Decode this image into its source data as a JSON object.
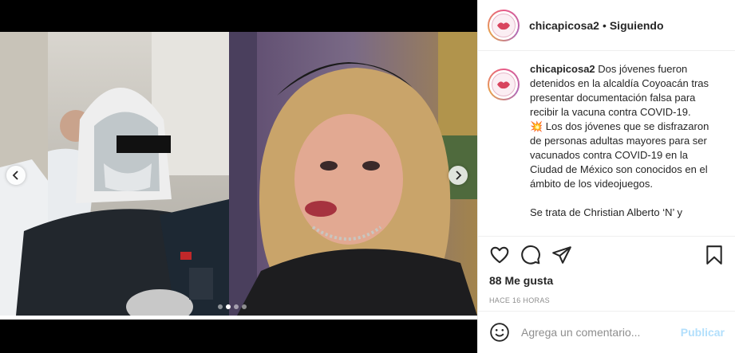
{
  "post": {
    "username": "chicapicosa2",
    "separator": "•",
    "follow_label": "Siguiendo",
    "caption_user": "chicapicosa2",
    "caption_p1": " Dos jóvenes fueron detenidos en la alcaldía Coyoacán tras presentar documentación falsa para recibir la vacuna contra COVID-19.",
    "caption_p2": "💥 Los dos jóvenes que se disfrazaron de personas adultas mayores para ser vacunados contra COVID-19 en la Ciudad de México son conocidos en el ámbito de los videojuegos.",
    "caption_p3": "Se trata de Christian Alberto ‘N’ y",
    "likes": "88 Me gusta",
    "time": "HACE 16 HORAS",
    "comment_placeholder": "Agrega un comentario...",
    "publish_label": "Publicar"
  },
  "carousel": {
    "slide_count": 4,
    "active_index": 1
  },
  "icons": {
    "like": "heart-icon",
    "comment": "comment-icon",
    "share": "share-icon",
    "save": "bookmark-icon",
    "emoji": "emoji-icon",
    "prev": "chevron-left-icon",
    "next": "chevron-right-icon"
  },
  "colors": {
    "text": "#262626",
    "muted": "#8e8e8e",
    "publish_disabled": "#b2dffc"
  }
}
